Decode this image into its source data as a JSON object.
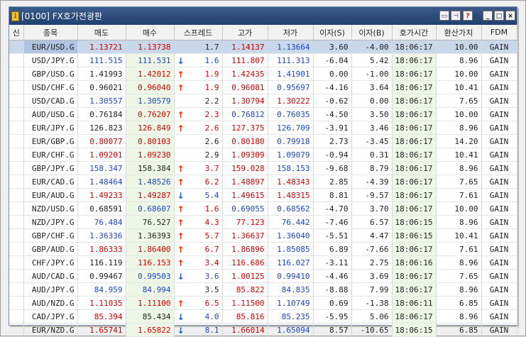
{
  "window": {
    "title": "[0100] FX호가전광판"
  },
  "columns": [
    "신",
    "종목",
    "매도",
    "매수",
    "스프레드",
    "고가",
    "저가",
    "이자(S)",
    "이자(B)",
    "호가시간",
    "환산가치",
    "FDM"
  ],
  "rows": [
    {
      "sym": "EUR/USD.G",
      "bid": "1.13721",
      "ask": "1.13738",
      "dir": "",
      "spread": "1.7",
      "high": "1.14137",
      "low": "1.13664",
      "intS": "3.60",
      "intB": "-4.00",
      "time": "18:06:17",
      "value": "10.00",
      "fdm": "GAIN",
      "bidc": "red",
      "askc": "red",
      "highc": "red",
      "lowc": "blue"
    },
    {
      "sym": "USD/JPY.G",
      "bid": "111.515",
      "ask": "111.531",
      "dir": "down",
      "spread": "1.6",
      "high": "111.807",
      "low": "111.313",
      "intS": "-6.04",
      "intB": "5.42",
      "time": "18:06:17",
      "value": "8.96",
      "fdm": "GAIN",
      "bidc": "blue",
      "askc": "blue",
      "highc": "red",
      "lowc": "blue"
    },
    {
      "sym": "GBP/USD.G",
      "bid": "1.41993",
      "ask": "1.42012",
      "dir": "up",
      "spread": "1.9",
      "high": "1.42435",
      "low": "1.41901",
      "intS": "0.00",
      "intB": "-1.00",
      "time": "18:06:17",
      "value": "10.00",
      "fdm": "GAIN",
      "bidc": "",
      "askc": "red",
      "highc": "red",
      "lowc": "blue"
    },
    {
      "sym": "USD/CHF.G",
      "bid": "0.96021",
      "ask": "0.96040",
      "dir": "up",
      "spread": "1.9",
      "high": "0.96081",
      "low": "0.95697",
      "intS": "-4.16",
      "intB": "3.64",
      "time": "18:06:17",
      "value": "10.41",
      "fdm": "GAIN",
      "bidc": "",
      "askc": "red",
      "highc": "red",
      "lowc": "blue"
    },
    {
      "sym": "USD/CAD.G",
      "bid": "1.30557",
      "ask": "1.30579",
      "dir": "",
      "spread": "2.2",
      "high": "1.30794",
      "low": "1.30222",
      "intS": "-0.62",
      "intB": "0.00",
      "time": "18:06:17",
      "value": "7.65",
      "fdm": "GAIN",
      "bidc": "blue",
      "askc": "blue",
      "highc": "red",
      "lowc": "red"
    },
    {
      "sym": "AUD/USD.G",
      "bid": "0.76184",
      "ask": "0.76207",
      "dir": "up",
      "spread": "2.3",
      "high": "0.76812",
      "low": "0.76035",
      "intS": "-4.50",
      "intB": "3.50",
      "time": "18:06:17",
      "value": "10.00",
      "fdm": "GAIN",
      "bidc": "",
      "askc": "red",
      "highc": "blue",
      "lowc": "blue"
    },
    {
      "sym": "EUR/JPY.G",
      "bid": "126.823",
      "ask": "126.849",
      "dir": "up",
      "spread": "2.6",
      "high": "127.375",
      "low": "126.709",
      "intS": "-3.91",
      "intB": "3.46",
      "time": "18:06:17",
      "value": "8.96",
      "fdm": "GAIN",
      "bidc": "",
      "askc": "red",
      "highc": "red",
      "lowc": "blue"
    },
    {
      "sym": "EUR/GBP.G",
      "bid": "0.80077",
      "ask": "0.80103",
      "dir": "",
      "spread": "2.6",
      "high": "0.80180",
      "low": "0.79918",
      "intS": "2.73",
      "intB": "-3.45",
      "time": "18:06:17",
      "value": "14.20",
      "fdm": "GAIN",
      "bidc": "red",
      "askc": "red",
      "highc": "red",
      "lowc": "blue"
    },
    {
      "sym": "EUR/CHF.G",
      "bid": "1.09201",
      "ask": "1.09230",
      "dir": "",
      "spread": "2.9",
      "high": "1.09309",
      "low": "1.09079",
      "intS": "-0.94",
      "intB": "0.31",
      "time": "18:06:17",
      "value": "10.41",
      "fdm": "GAIN",
      "bidc": "red",
      "askc": "red",
      "highc": "red",
      "lowc": "blue"
    },
    {
      "sym": "GBP/JPY.G",
      "bid": "158.347",
      "ask": "158.384",
      "dir": "up",
      "spread": "3.7",
      "high": "159.028",
      "low": "158.153",
      "intS": "-9.68",
      "intB": "8.79",
      "time": "18:06:17",
      "value": "8.96",
      "fdm": "GAIN",
      "bidc": "blue",
      "askc": "",
      "highc": "red",
      "lowc": "blue"
    },
    {
      "sym": "EUR/CAD.G",
      "bid": "1.48464",
      "ask": "1.48526",
      "dir": "up",
      "spread": "6.2",
      "high": "1.48897",
      "low": "1.48343",
      "intS": "2.85",
      "intB": "-4.39",
      "time": "18:06:17",
      "value": "7.65",
      "fdm": "GAIN",
      "bidc": "blue",
      "askc": "blue",
      "highc": "red",
      "lowc": "red"
    },
    {
      "sym": "EUR/AUD.G",
      "bid": "1.49233",
      "ask": "1.49287",
      "dir": "down",
      "spread": "5.4",
      "high": "1.49615",
      "low": "1.48315",
      "intS": "8.81",
      "intB": "-9.57",
      "time": "18:06:17",
      "value": "7.61",
      "fdm": "GAIN",
      "bidc": "red",
      "askc": "red",
      "highc": "red",
      "lowc": "red"
    },
    {
      "sym": "NZD/USD.G",
      "bid": "0.68591",
      "ask": "0.68607",
      "dir": "up",
      "spread": "1.6",
      "high": "0.69055",
      "low": "0.68562",
      "intS": "-4.70",
      "intB": "3.70",
      "time": "18:06:17",
      "value": "10.00",
      "fdm": "GAIN",
      "bidc": "",
      "askc": "blue",
      "highc": "blue",
      "lowc": "blue"
    },
    {
      "sym": "NZD/JPY.G",
      "bid": "76.484",
      "ask": "76.527",
      "dir": "up",
      "spread": "4.3",
      "high": "77.123",
      "low": "76.442",
      "intS": "-7.46",
      "intB": "6.57",
      "time": "18:06:15",
      "value": "8.96",
      "fdm": "GAIN",
      "bidc": "blue",
      "askc": "",
      "highc": "red",
      "lowc": "blue"
    },
    {
      "sym": "GBP/CHF.G",
      "bid": "1.36336",
      "ask": "1.36393",
      "dir": "up",
      "spread": "5.7",
      "high": "1.36637",
      "low": "1.36040",
      "intS": "-5.51",
      "intB": "4.47",
      "time": "18:06:15",
      "value": "10.41",
      "fdm": "GAIN",
      "bidc": "blue",
      "askc": "",
      "highc": "red",
      "lowc": "blue"
    },
    {
      "sym": "GBP/AUD.G",
      "bid": "1.86333",
      "ask": "1.86400",
      "dir": "up",
      "spread": "6.7",
      "high": "1.86896",
      "low": "1.85085",
      "intS": "6.89",
      "intB": "-7.66",
      "time": "18:06:17",
      "value": "7.61",
      "fdm": "GAIN",
      "bidc": "red",
      "askc": "red",
      "highc": "red",
      "lowc": "blue"
    },
    {
      "sym": "CHF/JPY.G",
      "bid": "116.119",
      "ask": "116.153",
      "dir": "up",
      "spread": "3.4",
      "high": "116.686",
      "low": "116.027",
      "intS": "-3.11",
      "intB": "2.75",
      "time": "18:06:16",
      "value": "8.96",
      "fdm": "GAIN",
      "bidc": "",
      "askc": "red",
      "highc": "red",
      "lowc": "blue"
    },
    {
      "sym": "AUD/CAD.G",
      "bid": "0.99467",
      "ask": "0.99503",
      "dir": "down",
      "spread": "3.6",
      "high": "1.00125",
      "low": "0.99410",
      "intS": "-4.46",
      "intB": "3.69",
      "time": "18:06:17",
      "value": "7.65",
      "fdm": "GAIN",
      "bidc": "",
      "askc": "blue",
      "highc": "red",
      "lowc": "blue"
    },
    {
      "sym": "AUD/JPY.G",
      "bid": "84.959",
      "ask": "84.994",
      "dir": "",
      "spread": "3.5",
      "high": "85.822",
      "low": "84.835",
      "intS": "-8.88",
      "intB": "7.99",
      "time": "18:06:17",
      "value": "8.96",
      "fdm": "GAIN",
      "bidc": "blue",
      "askc": "blue",
      "highc": "red",
      "lowc": "blue"
    },
    {
      "sym": "AUD/NZD.G",
      "bid": "1.11035",
      "ask": "1.11100",
      "dir": "up",
      "spread": "6.5",
      "high": "1.11500",
      "low": "1.10749",
      "intS": "0.69",
      "intB": "-1.38",
      "time": "18:06:11",
      "value": "6.85",
      "fdm": "GAIN",
      "bidc": "red",
      "askc": "red",
      "highc": "red",
      "lowc": "blue"
    },
    {
      "sym": "CAD/JPY.G",
      "bid": "85.394",
      "ask": "85.434",
      "dir": "down",
      "spread": "4.0",
      "high": "85.816",
      "low": "85.235",
      "intS": "-5.95",
      "intB": "5.06",
      "time": "18:06:17",
      "value": "8.96",
      "fdm": "GAIN",
      "bidc": "red",
      "askc": "",
      "highc": "red",
      "lowc": "blue"
    },
    {
      "sym": "EUR/NZD.G",
      "bid": "1.65741",
      "ask": "1.65822",
      "dir": "down",
      "spread": "8.1",
      "high": "1.66014",
      "low": "1.65094",
      "intS": "8.57",
      "intB": "-10.65",
      "time": "18:06:15",
      "value": "6.85",
      "fdm": "GAIN",
      "bidc": "red",
      "askc": "red",
      "highc": "red",
      "lowc": "blue"
    }
  ]
}
